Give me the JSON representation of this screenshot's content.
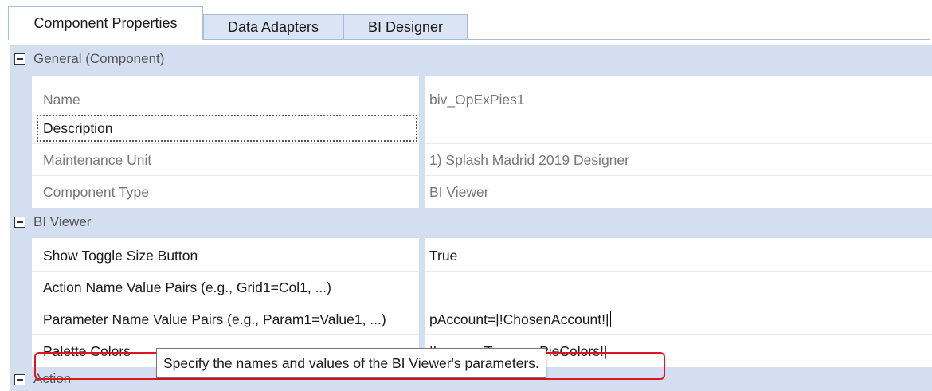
{
  "tabs": [
    {
      "label": "Component Properties",
      "active": true
    },
    {
      "label": "Data Adapters",
      "active": false
    },
    {
      "label": "BI Designer",
      "active": false
    }
  ],
  "grid": {
    "categories": {
      "general": "General (Component)",
      "bi_viewer": "BI Viewer",
      "action": "Action"
    },
    "rows": {
      "name": {
        "label": "Name",
        "value": "biv_OpExPies1"
      },
      "description": {
        "label": "Description",
        "value": ""
      },
      "maintenance_unit": {
        "label": "Maintenance Unit",
        "value": "1) Splash Madrid 2019 Designer"
      },
      "component_type": {
        "label": "Component Type",
        "value": "BI Viewer"
      },
      "show_toggle": {
        "label": "Show Toggle Size Button",
        "value": "True"
      },
      "action_pairs": {
        "label": "Action Name Value Pairs (e.g., Grid1=Col1, ...)",
        "value": ""
      },
      "param_pairs": {
        "label": "Parameter Name Value Pairs (e.g., Param1=Value1, ...)",
        "value": "pAccount=|!ChosenAccount!|"
      },
      "palette": {
        "label": "Palette Colors",
        "value": "|!param_TreemapPieColors!|"
      }
    }
  },
  "tooltip": "Specify the names and values of the BI Viewer's parameters.",
  "colors": {
    "category_bg": "#d3def0",
    "highlight_border": "#e0141e",
    "tab_bg": "#d9e4f4"
  }
}
